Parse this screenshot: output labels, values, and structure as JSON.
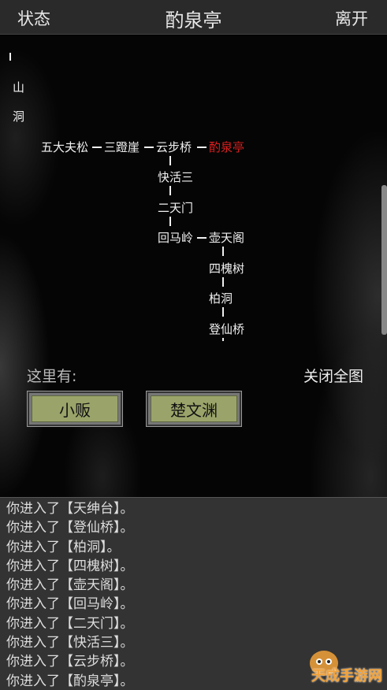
{
  "header": {
    "left_label": "状态",
    "title": "酌泉亭",
    "right_label": "离开"
  },
  "map": {
    "partial_nodes": [
      "山",
      "洞"
    ],
    "route_main": [
      "五大夫松",
      "三蹬崖",
      "云步桥"
    ],
    "current": "酌泉亭",
    "branch1": [
      "快活三",
      "二天门",
      "回马岭"
    ],
    "branch1_side": "壶天阁",
    "branch2": [
      "四槐树",
      "柏洞",
      "登仙桥"
    ]
  },
  "here": {
    "label": "这里有:",
    "close_label": "关闭全图",
    "npcs": [
      "小贩",
      "楚文渊"
    ]
  },
  "log": [
    "你进入了【天绅台】。",
    "你进入了【登仙桥】。",
    "你进入了【柏洞】。",
    "你进入了【四槐树】。",
    "你进入了【壶天阁】。",
    "你进入了【回马岭】。",
    "你进入了【二天门】。",
    "你进入了【快活三】。",
    "你进入了【云步桥】。",
    "你进入了【酌泉亭】。"
  ],
  "watermark": {
    "text": "天成手游网"
  },
  "colors": {
    "current_location": "#e02020",
    "npc_button": "#9aa46a",
    "log_bg": "#333333"
  }
}
